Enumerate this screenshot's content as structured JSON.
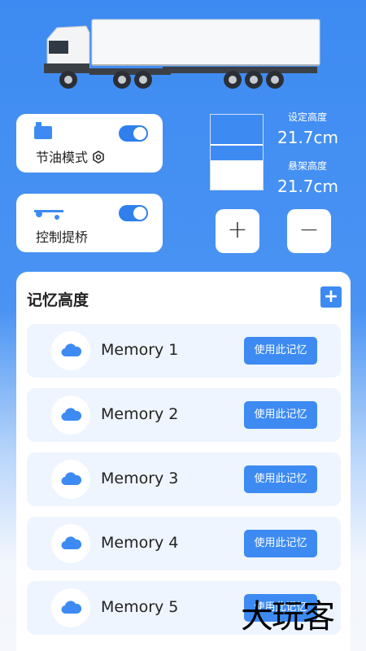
{
  "modes": [
    {
      "label": "节油模式",
      "settings_icon": "settings-icon",
      "icon": "fuel-can-icon",
      "enabled": true
    },
    {
      "label": "控制提桥",
      "icon": "axle-lift-icon",
      "enabled": true
    }
  ],
  "height": {
    "set_label": "设定高度",
    "set_value": "21.7cm",
    "suspension_label": "悬架高度",
    "suspension_value": "21.7cm"
  },
  "controls": {
    "plus": "+",
    "minus": "−"
  },
  "memory": {
    "title": "记忆高度",
    "add": "+",
    "items": [
      {
        "name": "Memory 1",
        "action": "使用此记忆"
      },
      {
        "name": "Memory 2",
        "action": "使用此记忆"
      },
      {
        "name": "Memory 3",
        "action": "使用此记忆"
      },
      {
        "name": "Memory 4",
        "action": "使用此记忆"
      },
      {
        "name": "Memory 5",
        "action": "使用此记忆"
      }
    ]
  },
  "watermark": "大玩客",
  "colors": {
    "accent": "#3d8bf2",
    "card": "#ffffff",
    "item_bg": "#eef5ff"
  }
}
